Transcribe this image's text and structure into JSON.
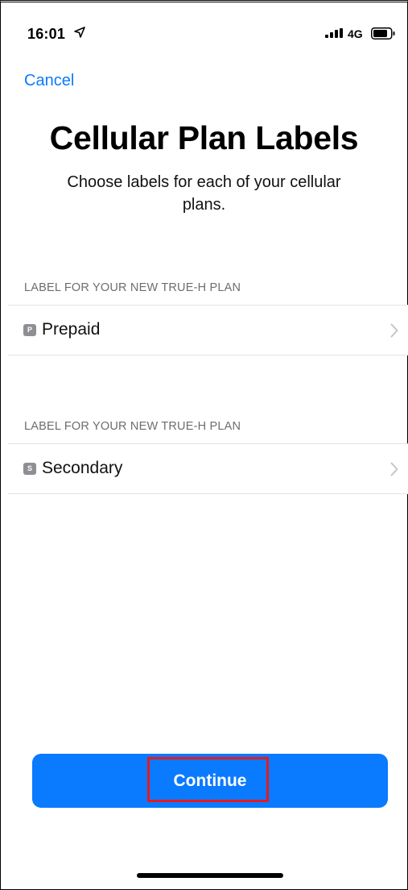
{
  "status_bar": {
    "time": "16:01",
    "network": "4G",
    "icons": [
      "location-icon",
      "signal-icon",
      "battery-icon"
    ]
  },
  "nav": {
    "cancel_label": "Cancel"
  },
  "header": {
    "title": "Cellular Plan Labels",
    "subtitle": "Choose labels for each of your cellular plans."
  },
  "sections": [
    {
      "header": "LABEL FOR YOUR NEW TRUE-H PLAN",
      "badge": "P",
      "label": "Prepaid"
    },
    {
      "header": "LABEL FOR YOUR NEW TRUE-H PLAN",
      "badge": "S",
      "label": "Secondary"
    }
  ],
  "footer": {
    "continue_label": "Continue"
  },
  "colors": {
    "accent": "#0a7aff",
    "highlight": "#e6191f",
    "section_header": "#6d6d72",
    "badge": "#8e8e93"
  }
}
